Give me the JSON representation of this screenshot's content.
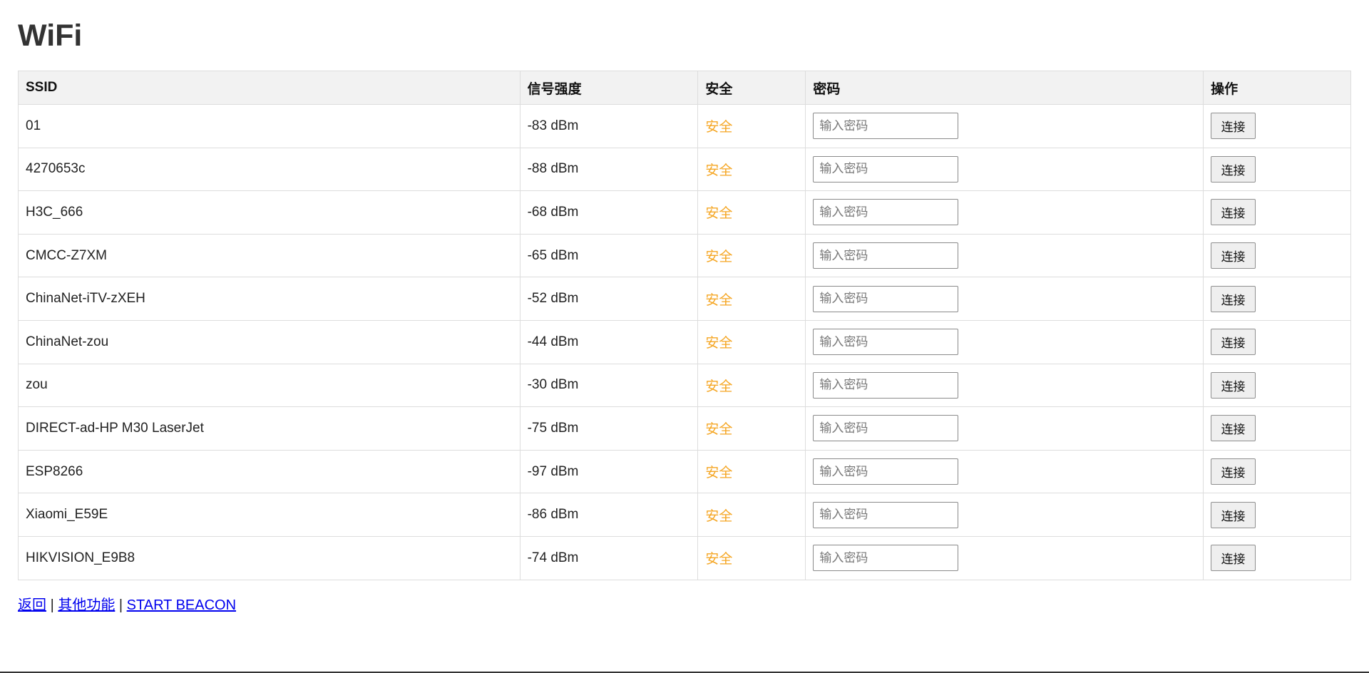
{
  "page": {
    "title": "WiFi"
  },
  "table": {
    "headers": {
      "ssid": "SSID",
      "signal": "信号强度",
      "security": "安全",
      "password": "密码",
      "action": "操作"
    },
    "rows": [
      {
        "ssid": "01",
        "signal": "-83 dBm",
        "security": "安全"
      },
      {
        "ssid": "4270653c",
        "signal": "-88 dBm",
        "security": "安全"
      },
      {
        "ssid": "H3C_666",
        "signal": "-68 dBm",
        "security": "安全"
      },
      {
        "ssid": "CMCC-Z7XM",
        "signal": "-65 dBm",
        "security": "安全"
      },
      {
        "ssid": "ChinaNet-iTV-zXEH",
        "signal": "-52 dBm",
        "security": "安全"
      },
      {
        "ssid": "ChinaNet-zou",
        "signal": "-44 dBm",
        "security": "安全"
      },
      {
        "ssid": "zou",
        "signal": "-30 dBm",
        "security": "安全"
      },
      {
        "ssid": "DIRECT-ad-HP M30 LaserJet",
        "signal": "-75 dBm",
        "security": "安全"
      },
      {
        "ssid": "ESP8266",
        "signal": "-97 dBm",
        "security": "安全"
      },
      {
        "ssid": "Xiaomi_E59E",
        "signal": "-86 dBm",
        "security": "安全"
      },
      {
        "ssid": "HIKVISION_E9B8",
        "signal": "-74 dBm",
        "security": "安全"
      }
    ],
    "password_placeholder": "输入密码",
    "connect_label": "连接"
  },
  "colors": {
    "secure_text": "#f5a623",
    "link": "#0000ee",
    "header_bg": "#f2f2f2"
  },
  "footer": {
    "links": [
      {
        "label": "返回"
      },
      {
        "label": "其他功能"
      },
      {
        "label": "START BEACON"
      }
    ],
    "separator": "|"
  }
}
